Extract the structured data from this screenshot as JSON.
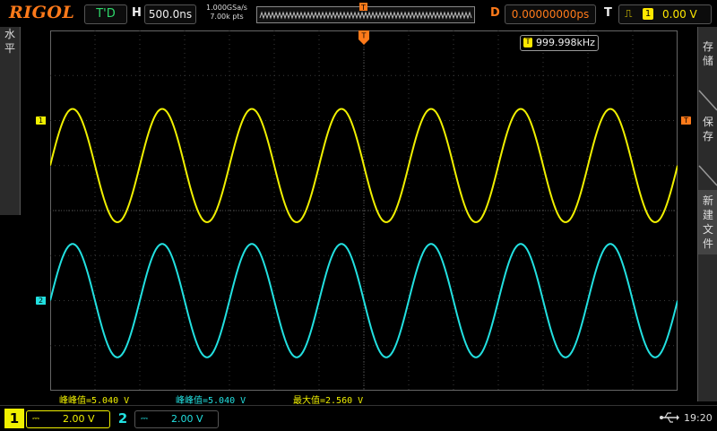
{
  "brand": "RIGOL",
  "topbar": {
    "mode": "T'D",
    "h_label": "H",
    "timebase": "500.0ns",
    "sample_rate": "1.000GSa/s",
    "mem_depth": "7.00k pts",
    "delay_label": "D",
    "delay": "0.00000000ps",
    "trigger_label": "T",
    "trigger_source": "1",
    "trigger_level": "0.00 V",
    "trigger_marker": "T"
  },
  "left_menu": {
    "label": "水平"
  },
  "right_menu": {
    "items": [
      "存储",
      "保存",
      "新建文件"
    ]
  },
  "frequency_counter": {
    "badge": "T",
    "value": "999.998kHz"
  },
  "channels": [
    {
      "number": "1",
      "color": "#f0f000",
      "coupling": "⎓",
      "scale": "2.00 V",
      "cycles": 7,
      "amplitude_div": 1.26,
      "offset_div": 1.0
    },
    {
      "number": "2",
      "color": "#22e0e0",
      "coupling": "⎓",
      "scale": "2.00 V",
      "cycles": 7,
      "amplitude_div": 1.26,
      "offset_div": -2.0
    }
  ],
  "trigger_right_marker": "T",
  "measurements": [
    {
      "text": "峰峰值=5.040 V",
      "color": "#f0f000"
    },
    {
      "text": "峰峰值=5.040 V",
      "color": "#22e0e0"
    },
    {
      "text": "最大值=2.560 V",
      "color": "#f0f000"
    }
  ],
  "statusbar": {
    "time": "19:20",
    "usb_icon": "usb-icon"
  }
}
